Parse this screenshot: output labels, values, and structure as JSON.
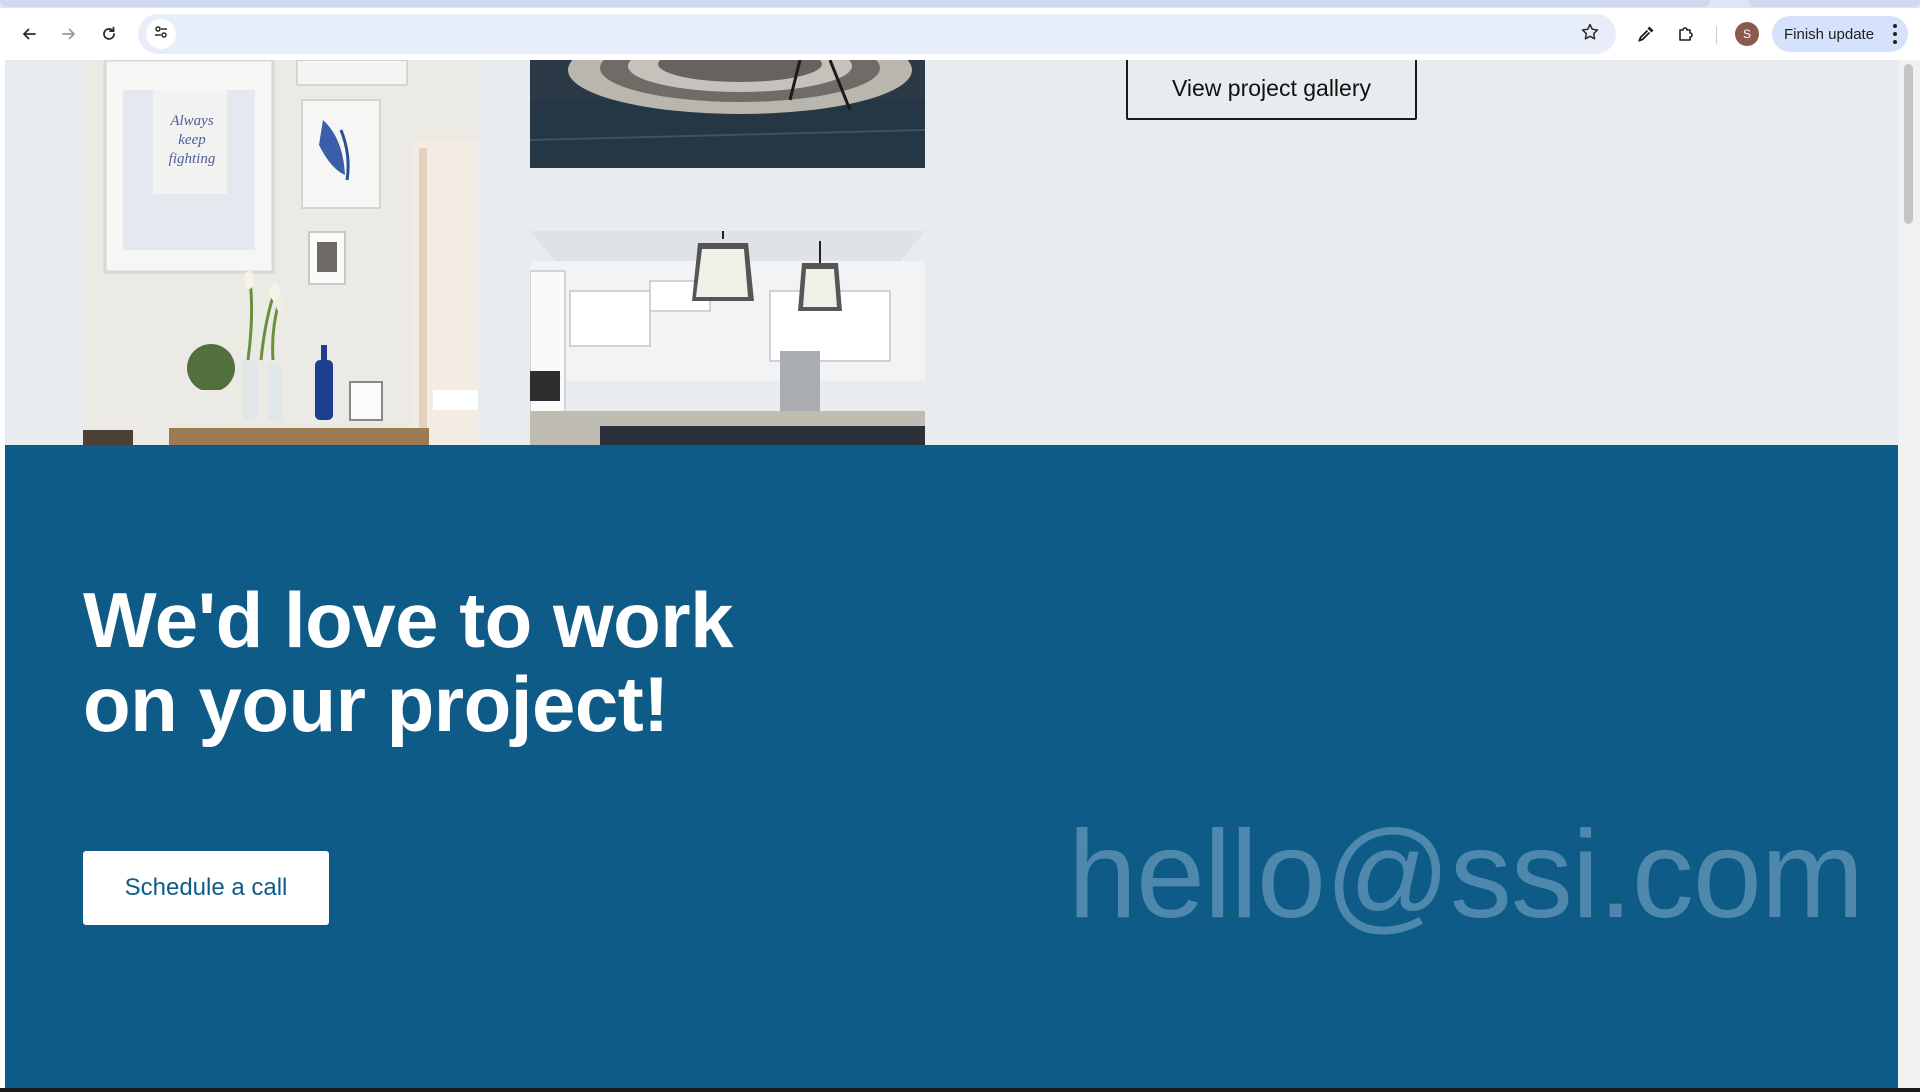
{
  "browser": {
    "address_text": "",
    "update_label": "Finish update",
    "avatar_initial": "S",
    "icons": {
      "back": "arrow-left-icon",
      "forward": "arrow-right-icon",
      "reload": "reload-icon",
      "site_info": "tune-icon",
      "bookmark": "star-icon",
      "eyedropper": "eyedropper-icon",
      "extensions": "puzzle-icon",
      "menu": "more-vert-icon"
    }
  },
  "gallery": {
    "button_label": "View project gallery",
    "art_print_text": "Always keep fighting"
  },
  "cta": {
    "heading_line1": "We'd love to work",
    "heading_line2": "on your project!",
    "schedule_label": "Schedule a call",
    "email": "hello@ssi.com"
  },
  "colors": {
    "cta_background": "#0e5b88",
    "page_background": "#e9ecef",
    "email_text": "#4f88ad",
    "update_pill": "#d6e2fb"
  }
}
